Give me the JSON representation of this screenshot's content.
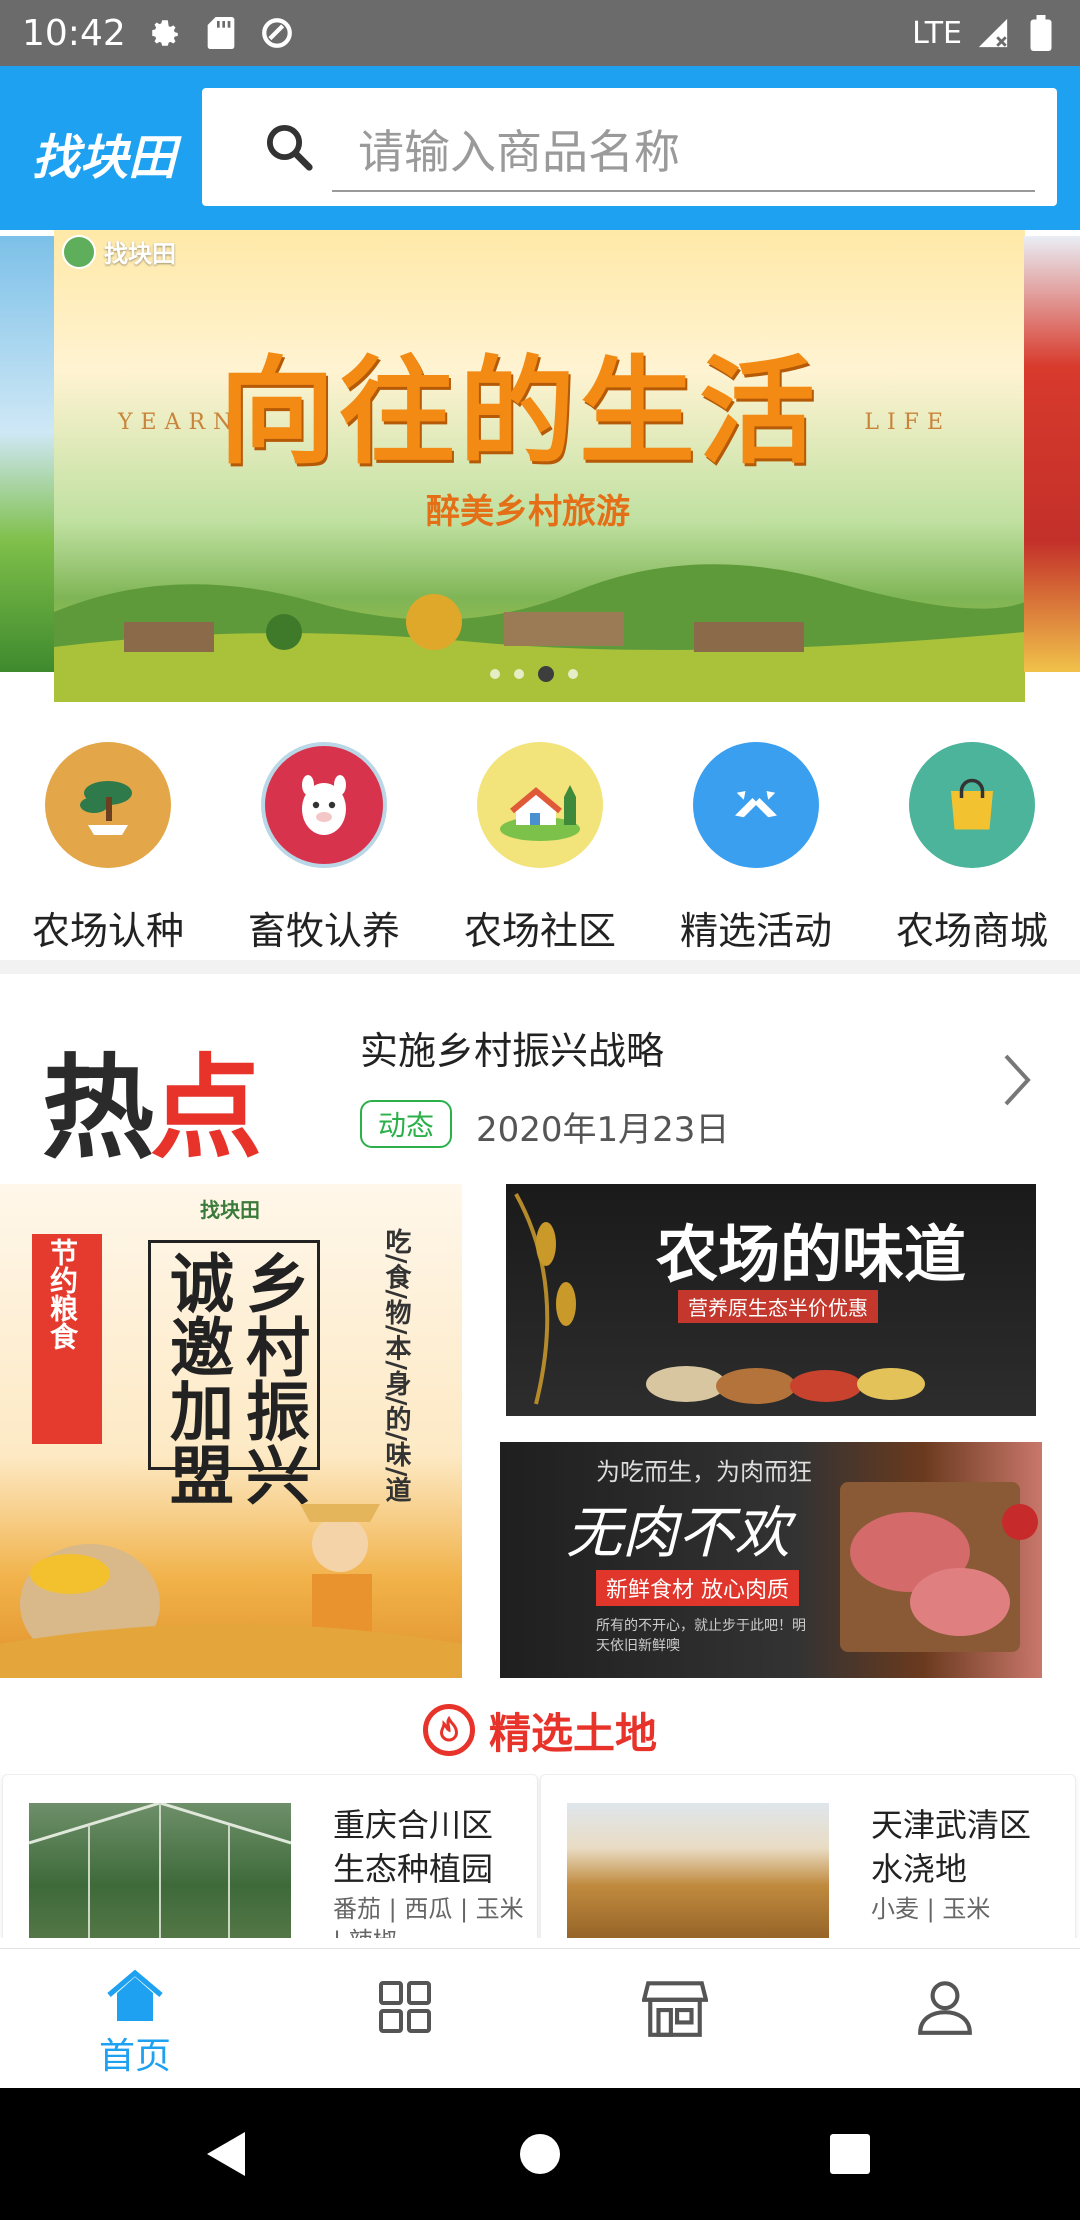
{
  "status_bar": {
    "time": "10:42",
    "network": "LTE"
  },
  "header": {
    "logo": "找块田",
    "search_placeholder": "请输入商品名称"
  },
  "banner": {
    "brand": "找块田",
    "title": "向往的生活",
    "subtitle": "醉美乡村旅游",
    "left_word": "YEARN",
    "right_word": "LIFE",
    "active_dot": 3,
    "dot_count": 4
  },
  "categories": [
    {
      "label": "农场认种",
      "icon": "bonsai-icon",
      "color": "#e3a74a"
    },
    {
      "label": "畜牧认养",
      "icon": "alpaca-icon",
      "color": "#d8334d"
    },
    {
      "label": "农场社区",
      "icon": "house-icon",
      "color": "#f2e37a"
    },
    {
      "label": "精选活动",
      "icon": "flags-icon",
      "color": "#3b9ff0"
    },
    {
      "label": "农场商城",
      "icon": "shopping-bag-icon",
      "color": "#4bb49b"
    }
  ],
  "hot": {
    "logo_a": "热",
    "logo_b": "点",
    "title": "实施乡村振兴战略",
    "tag": "动态",
    "date": "2020年1月23日"
  },
  "promos": {
    "p1": {
      "brand": "找块田",
      "line1": "诚邀加盟",
      "line2": "乡村振兴",
      "line3": "吃/食/物/本/身/的/味/道",
      "badge": "节约粮食"
    },
    "p2": {
      "title": "农场的味道",
      "sub": "营养原生态半价优惠"
    },
    "p3": {
      "top": "为吃而生，为肉而狂",
      "title": "无肉不欢",
      "sub": "新鲜食材 放心肉质",
      "note": "所有的不开心，就止步于此吧！明天依旧新鲜噢"
    }
  },
  "selected": {
    "title": "精选土地"
  },
  "lands": [
    {
      "name": "重庆合川区生态种植园",
      "crops": "番茄 | 西瓜 | 玉米 | 辣椒"
    },
    {
      "name": "天津武清区水浇地",
      "crops": "小麦 | 玉米"
    }
  ],
  "tabs": [
    {
      "label": "首页",
      "icon": "home-icon",
      "active": true
    },
    {
      "label": "",
      "icon": "grid-icon",
      "active": false
    },
    {
      "label": "",
      "icon": "store-icon",
      "active": false
    },
    {
      "label": "",
      "icon": "user-icon",
      "active": false
    }
  ],
  "colors": {
    "primary": "#1ea1f0",
    "accent_red": "#e7332a",
    "tag_green": "#2bb04a"
  }
}
